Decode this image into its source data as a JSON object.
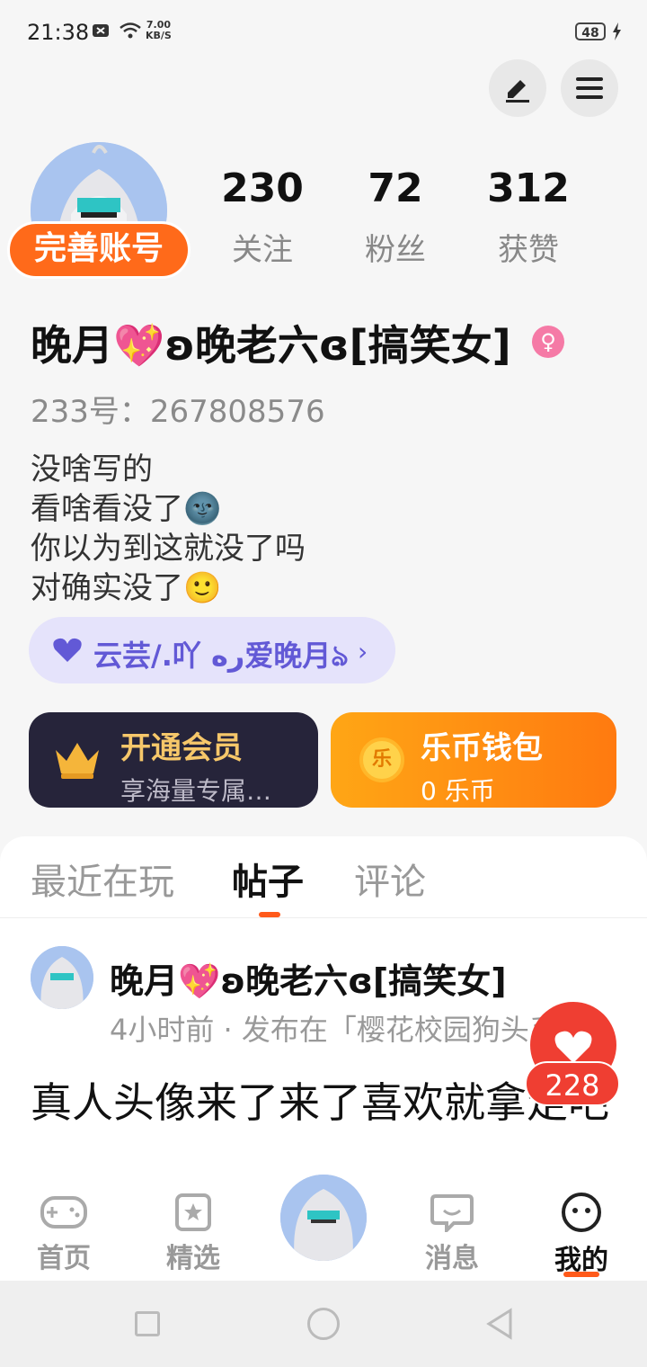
{
  "status": {
    "time": "21:38",
    "net_speed_value": "7.00",
    "net_speed_unit": "KB/S",
    "battery": "48"
  },
  "profile": {
    "complete_account": "完善账号",
    "stats": [
      {
        "value": "230",
        "label": "关注"
      },
      {
        "value": "72",
        "label": "粉丝"
      },
      {
        "value": "312",
        "label": "获赞"
      }
    ],
    "nickname": "晚月💖ʚ晚老六ɞ[搞笑女]",
    "uid": "233号：267808576",
    "bio": [
      "没啥写的",
      "看啥看没了🌚",
      "你以为到这就没了吗",
      "对确实没了🙂"
    ],
    "club": "云芸/.吖 ره爱晚月ঌ"
  },
  "cards": {
    "vip_title": "开通会员",
    "vip_sub": "享海量专属…",
    "wallet_title": "乐币钱包",
    "wallet_sub": "0 乐币",
    "wallet_coin_char": "乐"
  },
  "tabs": [
    {
      "label": "最近在玩",
      "active": false
    },
    {
      "label": "帖子",
      "active": true
    },
    {
      "label": "评论",
      "active": false
    }
  ],
  "post": {
    "author": "晚月💖ʚ晚老六ɞ[搞笑女]",
    "meta": "4小时前 · 发布在「樱花校园狗头系…",
    "text": "真人头像来了来了喜欢就拿走吧",
    "likes": "228"
  },
  "nav": [
    {
      "label": "首页",
      "icon": "gamepad-icon"
    },
    {
      "label": "精选",
      "icon": "star-bookmark-icon"
    },
    {
      "label": "消息",
      "icon": "chat-bubble-icon"
    },
    {
      "label": "我的",
      "icon": "smiley-face-icon"
    }
  ],
  "colors": {
    "accent": "#ff6a1a",
    "like": "#ef3e32",
    "club_text": "#6259d6"
  }
}
